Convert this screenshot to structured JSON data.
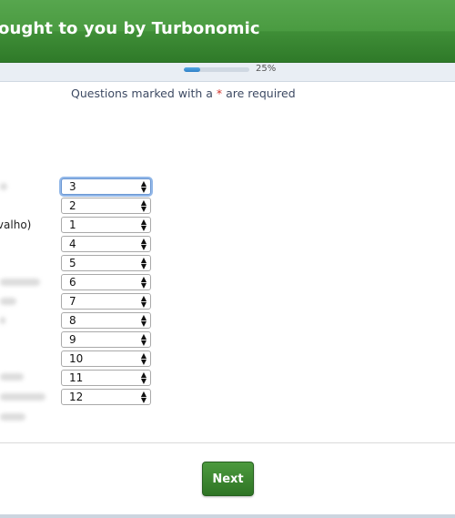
{
  "header": {
    "title": "ought to you by Turbonomic"
  },
  "progress": {
    "percent_label": "25%",
    "fraction": 0.25
  },
  "required_note": {
    "prefix": "Questions marked with a ",
    "star": "*",
    "suffix": " are required"
  },
  "row_label_partial": "rvalho)",
  "rank_selects": [
    {
      "value": "3"
    },
    {
      "value": "2"
    },
    {
      "value": "1"
    },
    {
      "value": "4"
    },
    {
      "value": "5"
    },
    {
      "value": "6"
    },
    {
      "value": "7"
    },
    {
      "value": "8"
    },
    {
      "value": "9"
    },
    {
      "value": "10"
    },
    {
      "value": "11"
    },
    {
      "value": "12"
    }
  ],
  "buttons": {
    "next_label": "Next"
  },
  "colors": {
    "header_green": "#3f8e37",
    "button_green": "#2e7424",
    "progress_blue": "#2e7fc6",
    "required_star": "#d0342c"
  }
}
